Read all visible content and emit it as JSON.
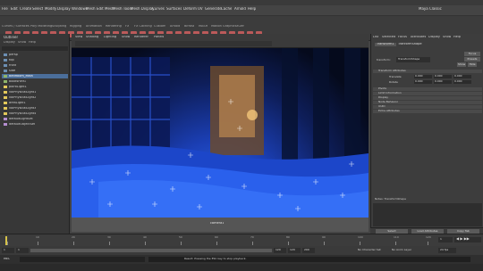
{
  "window": {
    "title": "Autodesk Maya",
    "workspace": "Maya Classic"
  },
  "menubar": {
    "items": [
      "File",
      "Edit",
      "Create",
      "Select",
      "Modify",
      "Display",
      "Windows",
      "Mesh",
      "Edit Mesh",
      "Mesh Tools",
      "Mesh Display",
      "Curves",
      "Surfaces",
      "Deform",
      "UV",
      "Generate",
      "Cache",
      "Arnold",
      "Help"
    ]
  },
  "shelf": {
    "tabs": [
      "Curves / Surfaces",
      "Poly Modeling",
      "Sculpting",
      "Rigging",
      "Animation",
      "Rendering",
      "FX",
      "FX Caching",
      "Custom",
      "Arnold",
      "Bifrost",
      "MASH",
      "Motion Graphics",
      "XGen"
    ]
  },
  "outliner": {
    "title": "Outliner",
    "menu": [
      "Display",
      "Show",
      "Help"
    ],
    "items": [
      "persp",
      "top",
      "front",
      "side",
      "BedRoom_Main",
      "bookshelf1",
      "pointLight1",
      "volPhysicalLight1",
      "volPhysicalLight2",
      "areaLight1",
      "volPhysicalLight3",
      "volPhysicalLight4",
      "defaultLightSet",
      "defaultObjectSet"
    ]
  },
  "viewport": {
    "menu": [
      "View",
      "Shading",
      "Lighting",
      "Show",
      "Renderer",
      "Panels"
    ],
    "camera_label": "camera1"
  },
  "attribute_editor": {
    "tabs": [
      "List",
      "Selected",
      "Focus",
      "Attributes",
      "Display",
      "Show",
      "Help"
    ],
    "node_tabs": [
      "Transform1",
      "TranformShape"
    ],
    "node_label": "transform:",
    "node_value": "TransformShape",
    "buttons": [
      "Focus",
      "Presets",
      "Show",
      "Hide"
    ],
    "sections": [
      "Transform Attributes",
      "Pivots",
      "Limit Information",
      "Display",
      "Node Behavior",
      "UUID",
      "Extra Attributes"
    ],
    "rows": [
      {
        "label": "Translate",
        "values": [
          "0.000",
          "0.000",
          "0.000"
        ]
      },
      {
        "label": "Rotate",
        "values": [
          "0.000",
          "0.000",
          "0.000"
        ]
      }
    ],
    "notes_label": "Notes: TransformShape",
    "bottom_buttons": [
      "Select",
      "Load Attributes",
      "Copy Tab"
    ]
  },
  "timeline": {
    "ticks": [
      "1",
      "10",
      "20",
      "30",
      "40",
      "50",
      "60",
      "70",
      "80",
      "90",
      "100",
      "110",
      "120"
    ],
    "current_frame": "1"
  },
  "range": {
    "start": "1",
    "start_inner": "1",
    "end_inner": "120",
    "end": "120",
    "anim_end": "200",
    "character_set": "No Character Set",
    "anim_layer": "No Anim Layer",
    "fps": "24 fps"
  },
  "cmdline": {
    "lang": "MEL"
  },
  "status": {
    "text": "Result: Pressing the ESC key to stop playback."
  }
}
